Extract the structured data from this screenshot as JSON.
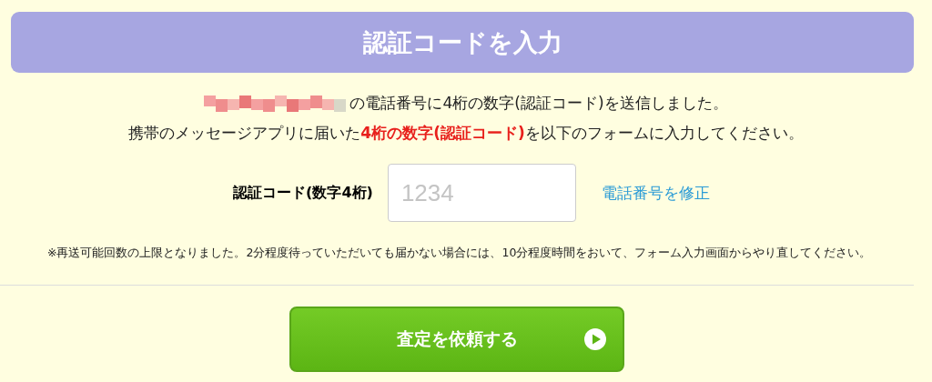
{
  "header": {
    "title": "認証コードを入力"
  },
  "message": {
    "line_1": "の電話番号に4桁の数字(認証コード)を送信しました。",
    "line_2": "携帯のメッセージアプリに届いた**4桁の数字(認証コード)**を以下のフォームに入力してください。"
  },
  "code_field": {
    "label": "認証コード(数字4桁)",
    "placeholder": "1234"
  },
  "edit_phone_link": "電話番号を修正",
  "note": "※再送可能回数の上限となりました。2分程度待っていただいても届かない場合には、10分程度時間をおいて、フォーム入力画面からやり直してください。",
  "submit_button": {
    "label": "査定を依頼する"
  }
}
